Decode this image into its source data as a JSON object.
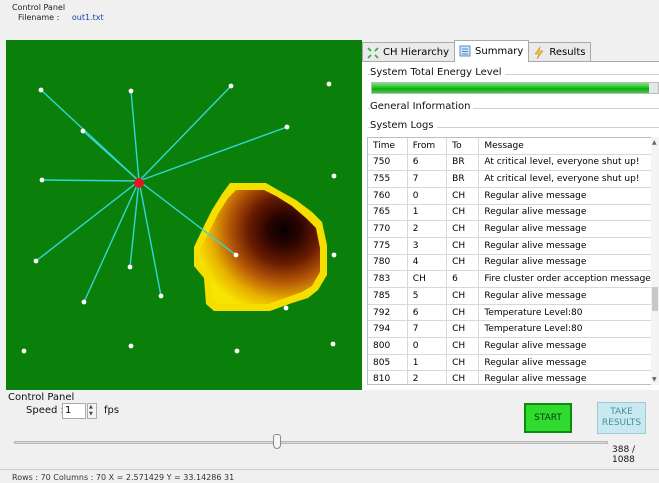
{
  "header": {
    "title": "Control Panel",
    "filename_label": "Filename :",
    "filename_value": "out1.txt"
  },
  "tabs": [
    {
      "label": "CH Hierarchy",
      "icon": "hierarchy-icon"
    },
    {
      "label": "Summary",
      "icon": "summary-icon",
      "active": true
    },
    {
      "label": "Results",
      "icon": "results-icon"
    }
  ],
  "summary": {
    "energy_label": "System Total Energy Level",
    "energy_level_percent": 97,
    "general_info_label": "General Information",
    "system_logs_label": "System Logs"
  },
  "logs": {
    "columns": [
      "Time",
      "From",
      "To",
      "Message"
    ],
    "rows": [
      [
        "750",
        "6",
        "BR",
        "At critical level, everyone shut up!"
      ],
      [
        "755",
        "7",
        "BR",
        "At critical level, everyone shut up!"
      ],
      [
        "760",
        "0",
        "CH",
        "Regular alive message"
      ],
      [
        "765",
        "1",
        "CH",
        "Regular alive message"
      ],
      [
        "770",
        "2",
        "CH",
        "Regular alive message"
      ],
      [
        "775",
        "3",
        "CH",
        "Regular alive message"
      ],
      [
        "780",
        "4",
        "CH",
        "Regular alive message"
      ],
      [
        "783",
        "CH",
        "6",
        "Fire cluster order acception message"
      ],
      [
        "785",
        "5",
        "CH",
        "Regular alive message"
      ],
      [
        "792",
        "6",
        "CH",
        "Temperature Level:80"
      ],
      [
        "794",
        "7",
        "CH",
        "Temperature Level:80"
      ],
      [
        "800",
        "0",
        "CH",
        "Regular alive message"
      ],
      [
        "805",
        "1",
        "CH",
        "Regular alive message"
      ],
      [
        "810",
        "2",
        "CH",
        "Regular alive message"
      ]
    ]
  },
  "control": {
    "title": "Control Panel",
    "speed_label": "Speed :",
    "speed_value": "1",
    "fps_label": "fps",
    "start_label": "START",
    "take_results_line1": "TAKE",
    "take_results_line2": "RESULTS",
    "progress_current": 388,
    "progress_total": 1088,
    "progress_text": "388 / 1088"
  },
  "status_text": "Rows : 70 Columns : 70  X = 2.571429 Y = 33.14286  31",
  "colors": {
    "field_green": "#0a800a",
    "link_cyan": "#33d6d6",
    "cluster_head_red": "#e8141e",
    "start_green": "#2edb2e"
  }
}
